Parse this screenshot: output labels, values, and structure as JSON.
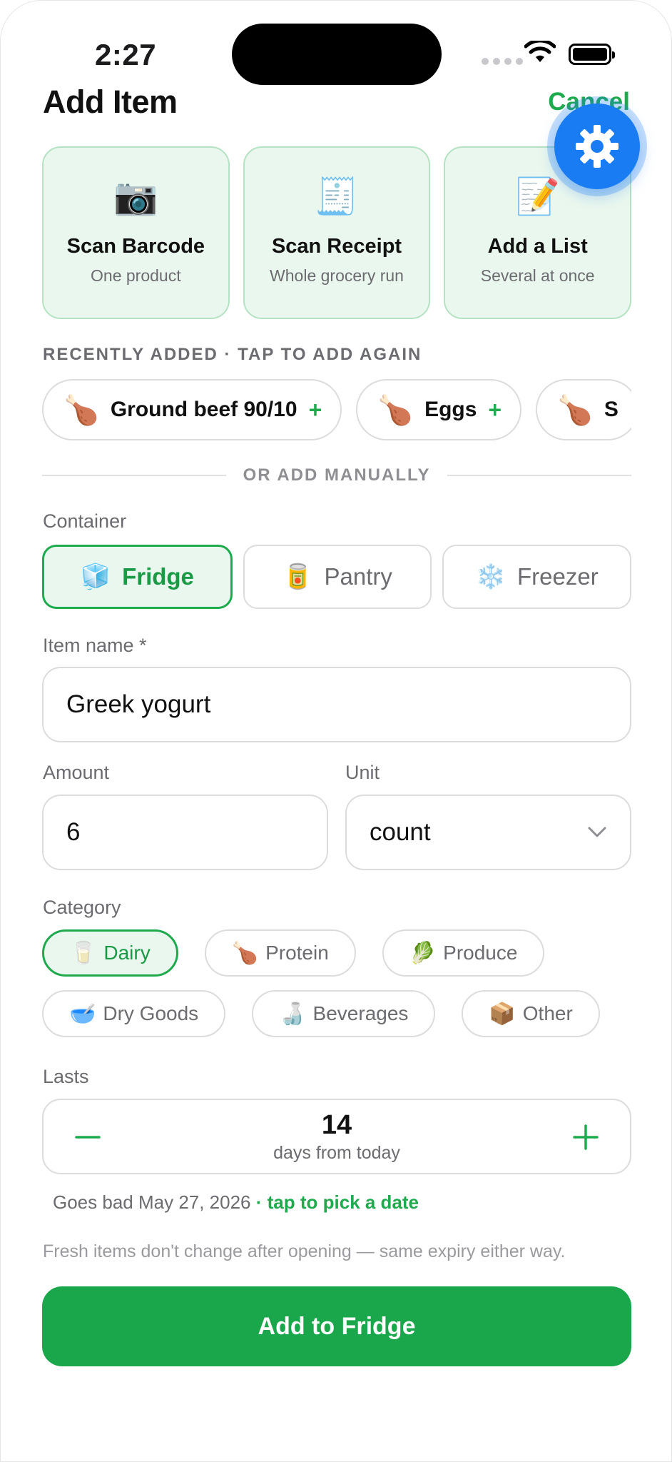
{
  "status_bar": {
    "time": "2:27"
  },
  "header": {
    "title": "Add Item",
    "cancel_label": "Cancel"
  },
  "quick_actions": [
    {
      "icon": "camera",
      "emoji": "📷",
      "title": "Scan Barcode",
      "subtitle": "One product"
    },
    {
      "icon": "receipt",
      "emoji": "🧾",
      "title": "Scan Receipt",
      "subtitle": "Whole grocery run"
    },
    {
      "icon": "memo",
      "emoji": "📝",
      "title": "Add a List",
      "subtitle": "Several at once"
    }
  ],
  "recent": {
    "label": "RECENTLY ADDED · TAP TO ADD AGAIN",
    "items": [
      {
        "emoji": "🍗",
        "name": "Ground beef 90/10",
        "plus": "+"
      },
      {
        "emoji": "🍗",
        "name": "Eggs",
        "plus": "+"
      },
      {
        "emoji": "🍗",
        "name": "S",
        "plus": ""
      }
    ]
  },
  "divider_label": "OR ADD MANUALLY",
  "container": {
    "label": "Container",
    "options": [
      {
        "emoji": "🧊",
        "label": "Fridge",
        "selected": true
      },
      {
        "emoji": "🥫",
        "label": "Pantry",
        "selected": false
      },
      {
        "emoji": "❄️",
        "label": "Freezer",
        "selected": false
      }
    ]
  },
  "item_name": {
    "label": "Item name *",
    "value": "Greek yogurt"
  },
  "amount": {
    "label": "Amount",
    "value": "6"
  },
  "unit": {
    "label": "Unit",
    "value": "count"
  },
  "category": {
    "label": "Category",
    "options": [
      {
        "emoji": "🥛",
        "label": "Dairy",
        "selected": true
      },
      {
        "emoji": "🍗",
        "label": "Protein",
        "selected": false
      },
      {
        "emoji": "🥬",
        "label": "Produce",
        "selected": false
      },
      {
        "emoji": "🥣",
        "label": "Dry Goods",
        "selected": false
      },
      {
        "emoji": "🍶",
        "label": "Beverages",
        "selected": false
      },
      {
        "emoji": "📦",
        "label": "Other",
        "selected": false
      }
    ]
  },
  "lasts": {
    "label": "Lasts",
    "days": "14",
    "sub": "days from today"
  },
  "expiry": {
    "text": "Goes bad May 27, 2026",
    "link": " · tap to pick a date"
  },
  "note": "Fresh items don't change after opening — same expiry either way.",
  "primary_button": "Add to Fridge",
  "colors": {
    "accent": "#1aa64a",
    "accent_light": "#eaf7ee",
    "fab": "#1a7cf2"
  }
}
